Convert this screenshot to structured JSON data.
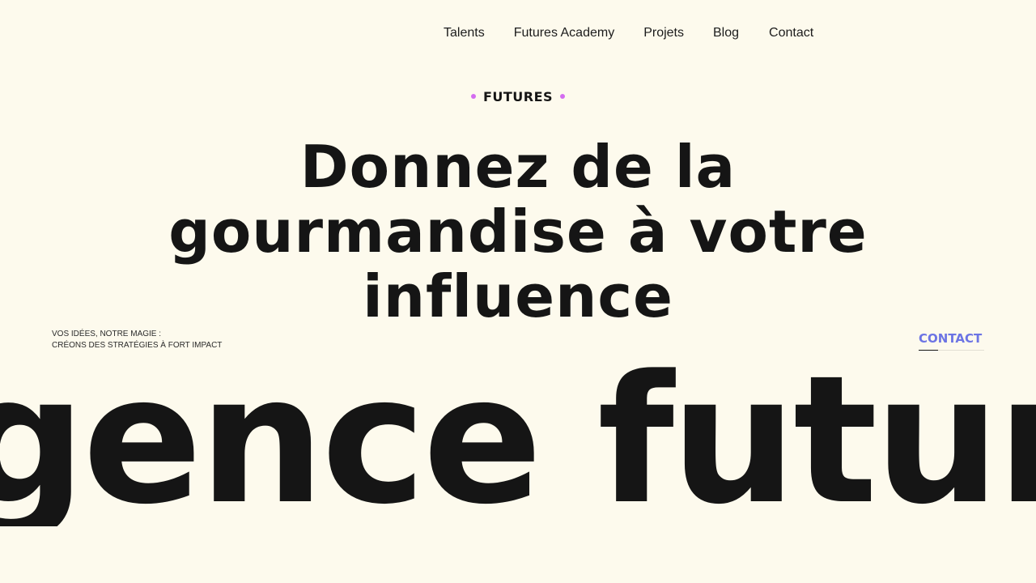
{
  "nav": {
    "items": [
      "Talents",
      "Futures Academy",
      "Projets",
      "Blog",
      "Contact"
    ]
  },
  "eyebrow": {
    "label": "FUTURES"
  },
  "hero": {
    "lines": [
      "Donnez de la",
      "gourmandise à votre",
      "influence"
    ]
  },
  "tagline": {
    "lines": [
      "VOS IDÉES, NOTRE MAGIE :",
      "CRÉONS DES STRATÉGIES À FORT IMPACT"
    ]
  },
  "cta": {
    "label": "CONTACT"
  },
  "marquee": {
    "text": "gence futures agence"
  },
  "colors": {
    "background": "#fdfaed",
    "text": "#151515",
    "accent_dot": "#d46cf0",
    "cta": "#6c74e4"
  }
}
